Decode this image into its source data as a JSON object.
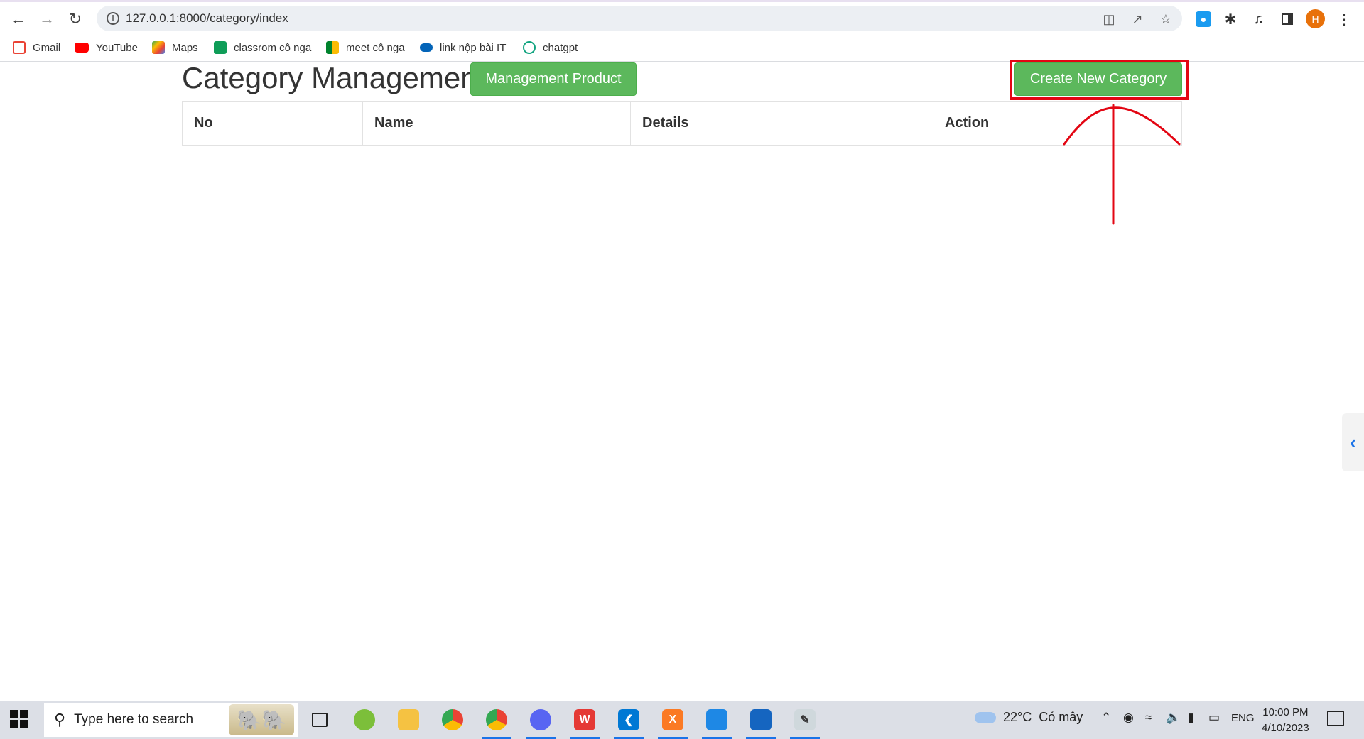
{
  "browser": {
    "url": "127.0.0.1:8000/category/index",
    "profile_initial": "H",
    "bookmarks": [
      {
        "label": "Gmail",
        "icon": "gmail-icon",
        "color": "#ea4335"
      },
      {
        "label": "YouTube",
        "icon": "youtube-icon",
        "color": "#ff0000"
      },
      {
        "label": "Maps",
        "icon": "maps-icon",
        "color": "#34a853"
      },
      {
        "label": "classrom cô nga",
        "icon": "classroom-icon",
        "color": "#0f9d58"
      },
      {
        "label": "meet cô nga",
        "icon": "meet-icon",
        "color": "#00832d"
      },
      {
        "label": "link nộp bài IT",
        "icon": "onedrive-icon",
        "color": "#0364b8"
      },
      {
        "label": "chatgpt",
        "icon": "chatgpt-icon",
        "color": "#10a37f"
      }
    ]
  },
  "page": {
    "title": "Category Management",
    "management_product_label": "Management Product",
    "create_category_label": "Create New Category",
    "accent_color": "#5cb85c",
    "annotation_color": "#e30613",
    "table": {
      "headers": [
        "No",
        "Name",
        "Details",
        "Action"
      ],
      "rows": []
    }
  },
  "taskbar": {
    "search_placeholder": "Type here to search",
    "weather": {
      "temp": "22°C",
      "condition": "Có mây"
    },
    "language": "ENG",
    "time": "10:00 PM",
    "date": "4/10/2023"
  }
}
